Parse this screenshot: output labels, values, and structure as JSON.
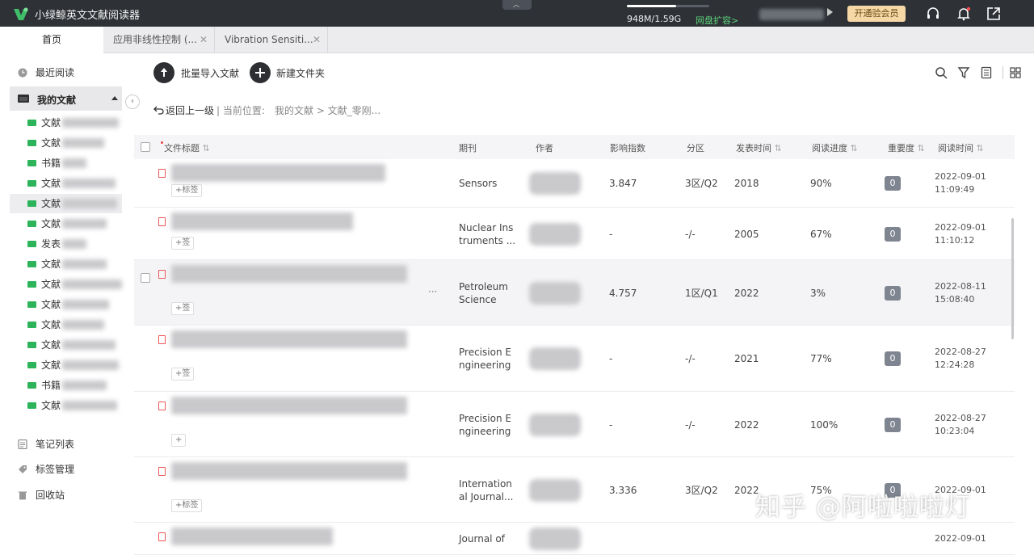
{
  "app": {
    "title": "小绿鲸英文文献阅读器",
    "quota_text": "948M/1.59G",
    "quota_used_fraction": 0.6,
    "expand_link": "网盘扩容>",
    "vip_button": "开通验会员",
    "collapse_icon": "chevron-up-icon"
  },
  "tabs": [
    {
      "label": "首页",
      "active": true
    },
    {
      "label": "应用非线性控制 (...",
      "active": false
    },
    {
      "label": "Vibration Sensiti...",
      "active": false
    }
  ],
  "sidebar": {
    "recent": "最近阅读",
    "mydocs": "我的文献",
    "folders": [
      "文献",
      "文献",
      "书籍",
      "文献",
      "文献",
      "文献",
      "发表",
      "文献",
      "文献",
      "文献",
      "文献",
      "文献",
      "文献",
      "书籍",
      "文献"
    ],
    "notes": "笔记列表",
    "tags": "标签管理",
    "trash": "回收站"
  },
  "toolbar": {
    "import": "批量导入文献",
    "new_folder": "新建文件夹",
    "back": "返回上一级",
    "location_label": "| 当前位置:",
    "location_path": "我的文献 > 文献_零刚..."
  },
  "table": {
    "headers": {
      "title": "文件标题",
      "journal": "期刊",
      "author": "作者",
      "impact": "影响指数",
      "zone": "分区",
      "year": "发表时间",
      "progress": "阅读进度",
      "importance": "重要度",
      "read_time": "阅读时间"
    },
    "sort_icon": "sort-icon",
    "rows": [
      {
        "journal": [
          "Sensors",
          ""
        ],
        "impact": "3.847",
        "zone": "3区/Q2",
        "year": "2018",
        "progress": "90%",
        "importance": "0",
        "date": "2022-09-01",
        "time": "11:09:49",
        "tag": "标签"
      },
      {
        "journal": [
          "Nuclear Ins",
          "truments ..."
        ],
        "impact": "-",
        "zone": "-/-",
        "year": "2005",
        "progress": "67%",
        "importance": "0",
        "date": "2022-09-01",
        "time": "11:10:12",
        "tag": "签"
      },
      {
        "journal": [
          "Petroleum",
          "Science"
        ],
        "impact": "4.757",
        "zone": "1区/Q1",
        "year": "2022",
        "progress": "3%",
        "importance": "0",
        "date": "2022-08-11",
        "time": "15:08:40",
        "tag": "签"
      },
      {
        "journal": [
          "Precision E",
          "ngineering"
        ],
        "impact": "-",
        "zone": "-/-",
        "year": "2021",
        "progress": "77%",
        "importance": "0",
        "date": "2022-08-27",
        "time": "12:24:28",
        "tag": "签"
      },
      {
        "journal": [
          "Precision E",
          "ngineering"
        ],
        "impact": "-",
        "zone": "-/-",
        "year": "2022",
        "progress": "100%",
        "importance": "0",
        "date": "2022-08-27",
        "time": "10:23:04",
        "tag": ""
      },
      {
        "journal": [
          "Internation",
          "al Journal..."
        ],
        "impact": "3.336",
        "zone": "3区/Q2",
        "year": "2022",
        "progress": "75%",
        "importance": "0",
        "date": "2022-09-01",
        "time": "",
        "tag": "标签"
      },
      {
        "journal": [
          "Journal of",
          ""
        ],
        "impact": "",
        "zone": "",
        "year": "",
        "progress": "",
        "importance": "",
        "date": "2022-09-01",
        "time": "",
        "tag": ""
      }
    ],
    "more_icon": "···"
  },
  "watermark": "知乎 @阿啦啦啦灯"
}
